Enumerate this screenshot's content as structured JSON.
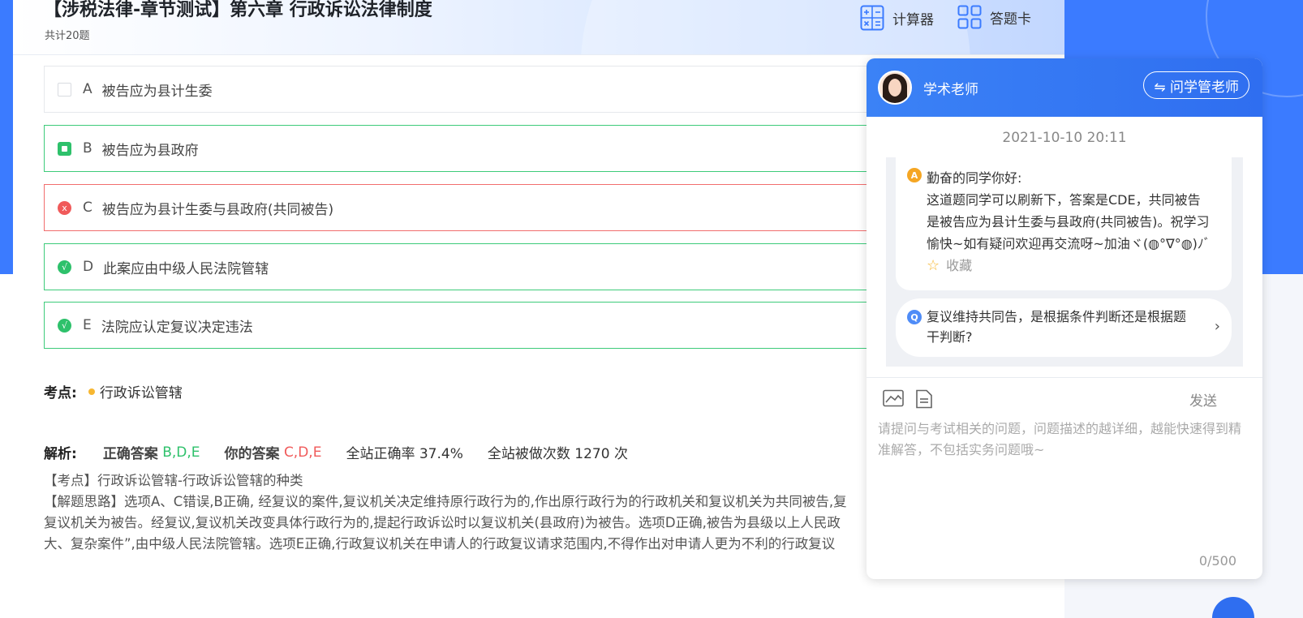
{
  "header": {
    "title": "【涉税法律-章节测试】第六章 行政诉讼法律制度",
    "subtitle": "共计20题",
    "calculator_label": "计算器",
    "answer_card_label": "答题卡"
  },
  "options": [
    {
      "letter": "A",
      "text": "被告应为县计生委",
      "state": "unselected"
    },
    {
      "letter": "B",
      "text": "被告应为县政府",
      "state": "selected-correct"
    },
    {
      "letter": "C",
      "text": "被告应为县计生委与县政府(共同被告)",
      "state": "wrong"
    },
    {
      "letter": "D",
      "text": "此案应由中级人民法院管辖",
      "state": "missed-correct"
    },
    {
      "letter": "E",
      "text": "法院应认定复议决定违法",
      "state": "missed-correct"
    }
  ],
  "kaodian": {
    "label": "考点:",
    "value": "行政诉讼管辖"
  },
  "jiexi": {
    "label": "解析:",
    "correct_label": "正确答案",
    "correct_value": "B,D,E",
    "yours_label": "你的答案",
    "yours_value": "C,D,E",
    "rate_text": "全站正确率 37.4%",
    "count_text": "全站被做次数 1270 次"
  },
  "explanation": {
    "line1": "【考点】行政诉讼管辖-行政诉讼管辖的种类",
    "line2": "【解题思路】选项A、C错误,B正确, 经复议的案件,复议机关决定维持原行政行为的,作出原行政行为的行政机关和复议机关为共同被告,复",
    "line3": "复议机关为被告。经复议,复议机关改变具体行政行为的,提起行政诉讼时以复议机关(县政府)为被告。选项D正确,被告为县级以上人民政",
    "line4": "大、复杂案件”,由中级人民法院管辖。选项E正确,行政复议机关在申请人的行政复议请求范围内,不得作出对申请人更为不利的行政复议"
  },
  "chat": {
    "teacher_name": "学术老师",
    "switch_label": "⇋ 问学管老师",
    "timestamp": "2021-10-10 20:11",
    "answer_badge": "A",
    "answer_line1": "勤奋的同学你好:",
    "answer_line2": "这道题同学可以刷新下，答案是CDE，共同被告",
    "answer_line3": "是被告应为县计生委与县政府(共同被告)。祝学习",
    "answer_line4": "愉快~如有疑问欢迎再交流呀~加油ヾ(◍°∇°◍)ﾉﾞ",
    "favorite_label": "收藏",
    "question_badge": "Q",
    "question_line1": "复议维持共同告，是根据条件判断还是根据题",
    "question_line2": "干判断?",
    "send_label": "发送",
    "input_placeholder": "请提问与考试相关的问题，问题描述的越详细，越能快速得到精准解答，不包括实务问题哦~",
    "counter": "0/500"
  }
}
